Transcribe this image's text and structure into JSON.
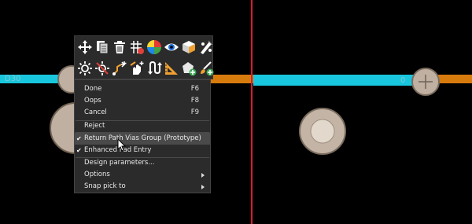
{
  "colors": {
    "background": "#000000",
    "trace_cyan": "#18c7dd",
    "trace_orange": "#d77b0d",
    "pad_fill": "#bfb0a2",
    "pad_ring": "#7a6c5e",
    "crosshair": "#e0182d",
    "menu_bg": "#2b2b2b",
    "menu_highlight": "#4a4a4a"
  },
  "canvas": {
    "trace_labels": [
      "D30",
      "0"
    ]
  },
  "toolbar": {
    "row1": [
      {
        "name": "move-icon",
        "title": "Move"
      },
      {
        "name": "copy-icon",
        "title": "Copy"
      },
      {
        "name": "delete-icon",
        "title": "Delete"
      },
      {
        "name": "grid-icon",
        "title": "Grid"
      },
      {
        "name": "color-wheel-icon",
        "title": "Color"
      },
      {
        "name": "visibility-eye-icon",
        "title": "Visibility"
      },
      {
        "name": "3d-box-icon",
        "title": "3D"
      },
      {
        "name": "paint-palette-icon",
        "title": "Palette"
      }
    ],
    "row2": [
      {
        "name": "highlight-sun-icon",
        "title": "Highlight"
      },
      {
        "name": "dehighlight-sun-icon",
        "title": "Dehighlight"
      },
      {
        "name": "route-add-icon",
        "title": "Route"
      },
      {
        "name": "slide-hand-icon",
        "title": "Slide"
      },
      {
        "name": "swap-pins-icon",
        "title": "Swap"
      },
      {
        "name": "measure-ruler-icon",
        "title": "Measure"
      },
      {
        "name": "add-shape-icon",
        "title": "Add Shape"
      },
      {
        "name": "add-brush-icon",
        "title": "Add Brush"
      }
    ]
  },
  "menu": {
    "items": [
      {
        "label": "Done",
        "shortcut": "F6"
      },
      {
        "label": "Oops",
        "shortcut": "F8"
      },
      {
        "label": "Cancel",
        "shortcut": "F9"
      },
      {
        "label": "Reject"
      },
      {
        "label": "Return Path Vias Group (Prototype)",
        "checked": "✔"
      },
      {
        "label": "Enhanced Pad Entry",
        "checked": "✔"
      },
      {
        "label": "Design parameters..."
      },
      {
        "label": "Options"
      },
      {
        "label": "Snap pick to"
      }
    ]
  }
}
